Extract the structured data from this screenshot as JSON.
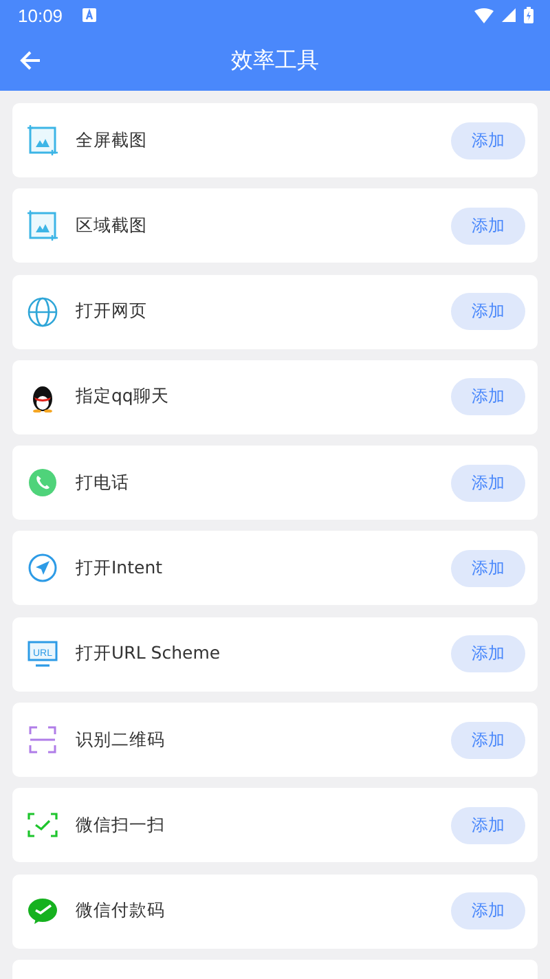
{
  "status_bar": {
    "time": "10:09"
  },
  "app_bar": {
    "title": "效率工具"
  },
  "items": [
    {
      "label": "全屏截图",
      "button": "添加"
    },
    {
      "label": "区域截图",
      "button": "添加"
    },
    {
      "label": "打开网页",
      "button": "添加"
    },
    {
      "label": "指定qq聊天",
      "button": "添加"
    },
    {
      "label": "打电话",
      "button": "添加"
    },
    {
      "label": "打开Intent",
      "button": "添加"
    },
    {
      "label": "打开URL Scheme",
      "icon_text": "URL",
      "button": "添加"
    },
    {
      "label": "识别二维码",
      "button": "添加"
    },
    {
      "label": "微信扫一扫",
      "button": "添加"
    },
    {
      "label": "微信付款码",
      "button": "添加"
    }
  ]
}
